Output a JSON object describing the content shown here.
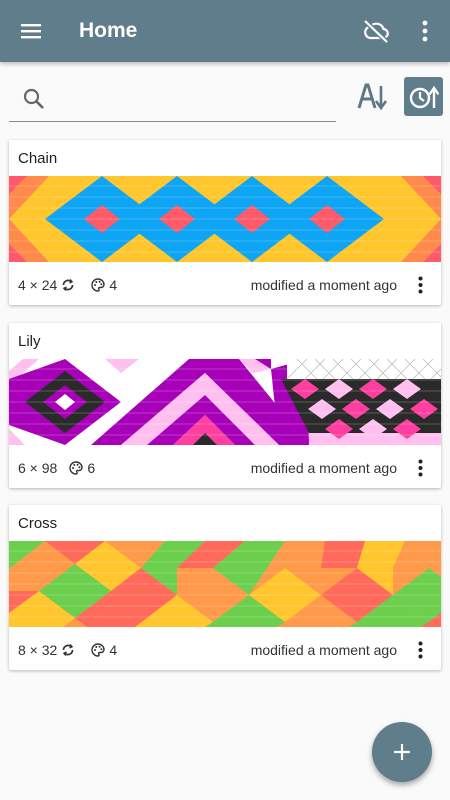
{
  "appbar": {
    "title": "Home",
    "menu_icon": "hamburger-menu-icon",
    "cloud_icon": "cloud-off-icon",
    "overflow_icon": "more-vert-icon"
  },
  "search": {
    "placeholder": "",
    "value": "",
    "icon": "search-icon"
  },
  "sort": {
    "alpha_icon": "sort-alphabetical-icon",
    "recent_icon": "sort-by-time-icon",
    "recent_active": true
  },
  "patterns": [
    {
      "name": "Chain",
      "dimensions": "4 × 24",
      "colors": "4",
      "modified": "modified a moment ago",
      "palette": [
        "#ffc62e",
        "#ff8a4c",
        "#ff5a6a",
        "#0ea5f5"
      ]
    },
    {
      "name": "Lily",
      "dimensions": "6 × 98",
      "colors": "6",
      "modified": "modified a moment ago",
      "palette": [
        "#ffffff",
        "#ffc0f0",
        "#a800b8",
        "#2a2a2a",
        "#ff3fa0",
        "#d0d0d0"
      ]
    },
    {
      "name": "Cross",
      "dimensions": "8 × 32",
      "colors": "4",
      "modified": "modified a moment ago",
      "palette": [
        "#ff6a5a",
        "#ff9a4a",
        "#ffc62e",
        "#6cd04e"
      ]
    }
  ],
  "fab": {
    "icon": "add-icon"
  },
  "colors": {
    "primary": "#607d8b",
    "background": "#fafafa"
  }
}
